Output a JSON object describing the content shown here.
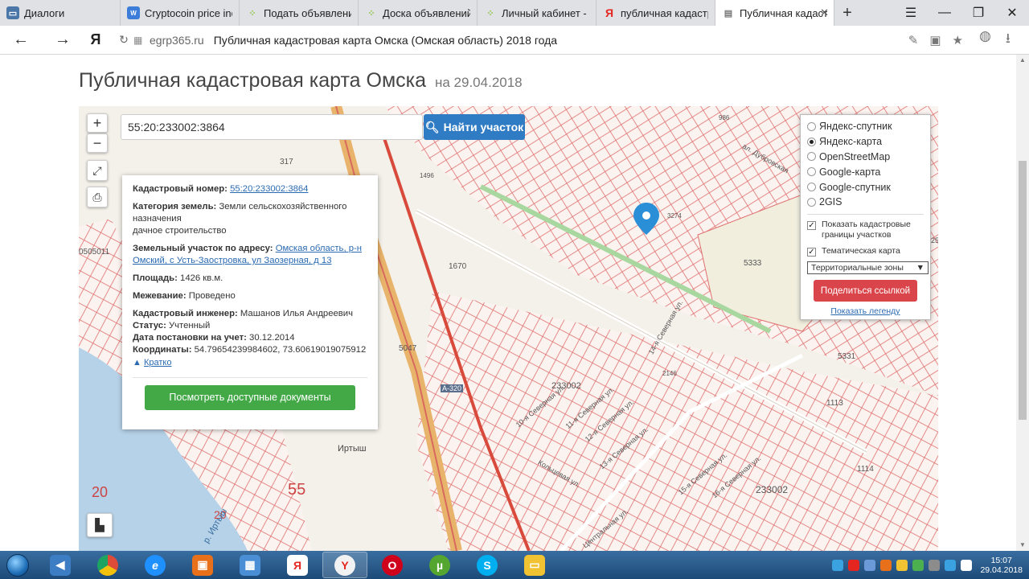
{
  "browser": {
    "tabs": [
      {
        "label": "Диалоги",
        "icon": "vk-icon",
        "color": "#4a76a8",
        "active": false
      },
      {
        "label": "Cryptocoin price inde",
        "icon": "crypto-icon",
        "color": "#3b7dd8",
        "active": false
      },
      {
        "label": "Подать объявление",
        "icon": "avito-icon",
        "color": "#8cc63f",
        "active": false
      },
      {
        "label": "Доска объявлений с",
        "icon": "avito-icon",
        "color": "#8cc63f",
        "active": false
      },
      {
        "label": "Личный кабинет - М",
        "icon": "avito-icon",
        "color": "#8cc63f",
        "active": false
      },
      {
        "label": "публичная кадастр",
        "icon": "yandex-icon",
        "color": "#e52620",
        "active": false
      },
      {
        "label": "Публичная кадаст",
        "icon": "page-icon",
        "color": "#777777",
        "active": true
      }
    ],
    "domain": "egrp365.ru",
    "page_title": "Публичная кадастровая карта Омска (Омская область) 2018 года"
  },
  "page": {
    "heading": "Публичная кадастровая карта Омска",
    "date": "на 29.04.2018"
  },
  "map": {
    "search_value": "55:20:233002:3864",
    "search_button": "Найти участок",
    "labels": [
      "317",
      "1670",
      "5333",
      "5047",
      "5331",
      "1113",
      "1114",
      "233002",
      "233002",
      "55",
      "20",
      "20",
      "0505011",
      "986",
      "1496",
      "3274",
      "2146",
      "Иртыш",
      "р. Иртыш",
      "А-320",
      "10-я Северная ул.",
      "11-я Северная ул.",
      "12-я Северная ул.",
      "13-я Северная ул.",
      "14-я Северная ул.",
      "15-я Северная ул.",
      "16-я Северная ул.",
      "Кольцевая ул.",
      "Центральная ул.",
      "ал. Дубровская",
      "25"
    ]
  },
  "info": {
    "cad_label": "Кадастровый номер:",
    "cad_value": "55:20:233002:3864",
    "cat_label": "Категория земель:",
    "cat_value": "Земли сельскохозяйственного назначения",
    "cat_use": "дачное строительство",
    "addr_label": "Земельный участок по адресу:",
    "addr_value": "Омская область, р-н Омский, с Усть-Заостровка, ул Заозерная, д 13",
    "area_label": "Площадь:",
    "area_value": "1426 кв.м.",
    "survey_label": "Межевание:",
    "survey_value": "Проведено",
    "engineer_label": "Кадастровый инженер:",
    "engineer_value": "Машанов Илья Андреевич",
    "status_label": "Статус:",
    "status_value": "Учтенный",
    "reg_label": "Дата постановки на учет:",
    "reg_value": "30.12.2014",
    "coords_label": "Координаты:",
    "coords_value": "54.79654239984602, 73.60619019075912",
    "short_link": "Кратко",
    "docs_button": "Посмотреть доступные документы"
  },
  "layers": {
    "options": [
      "Яндекс-спутник",
      "Яндекс-карта",
      "OpenStreetMap",
      "Google-карта",
      "Google-спутник",
      "2GIS"
    ],
    "selected": "Яндекс-карта",
    "show_borders": "Показать кадастровые границы участков",
    "thematic": "Тематическая карта",
    "zone_select": "Территориальные зоны",
    "share_button": "Поделиться ссылкой",
    "legend_link": "Показать легенду"
  },
  "taskbar": {
    "apps": [
      {
        "icon": "volume-icon",
        "color": "#3c7dc4"
      },
      {
        "icon": "chrome-icon",
        "color": "#dd4b39"
      },
      {
        "icon": "ie-icon",
        "color": "#1e90ff"
      },
      {
        "icon": "media-icon",
        "color": "#e8701a"
      },
      {
        "icon": "control-panel-icon",
        "color": "#4a8fd6"
      },
      {
        "icon": "yandex-icon",
        "color": "#e52620"
      },
      {
        "icon": "yandex-browser-icon",
        "color": "#f2f2f2"
      },
      {
        "icon": "opera-icon",
        "color": "#d0021b"
      },
      {
        "icon": "utorrent-icon",
        "color": "#55a630"
      },
      {
        "icon": "skype-icon",
        "color": "#00aff0"
      },
      {
        "icon": "explorer-icon",
        "color": "#f1c232"
      }
    ],
    "time": "15:07",
    "date": "29.04.2018"
  }
}
